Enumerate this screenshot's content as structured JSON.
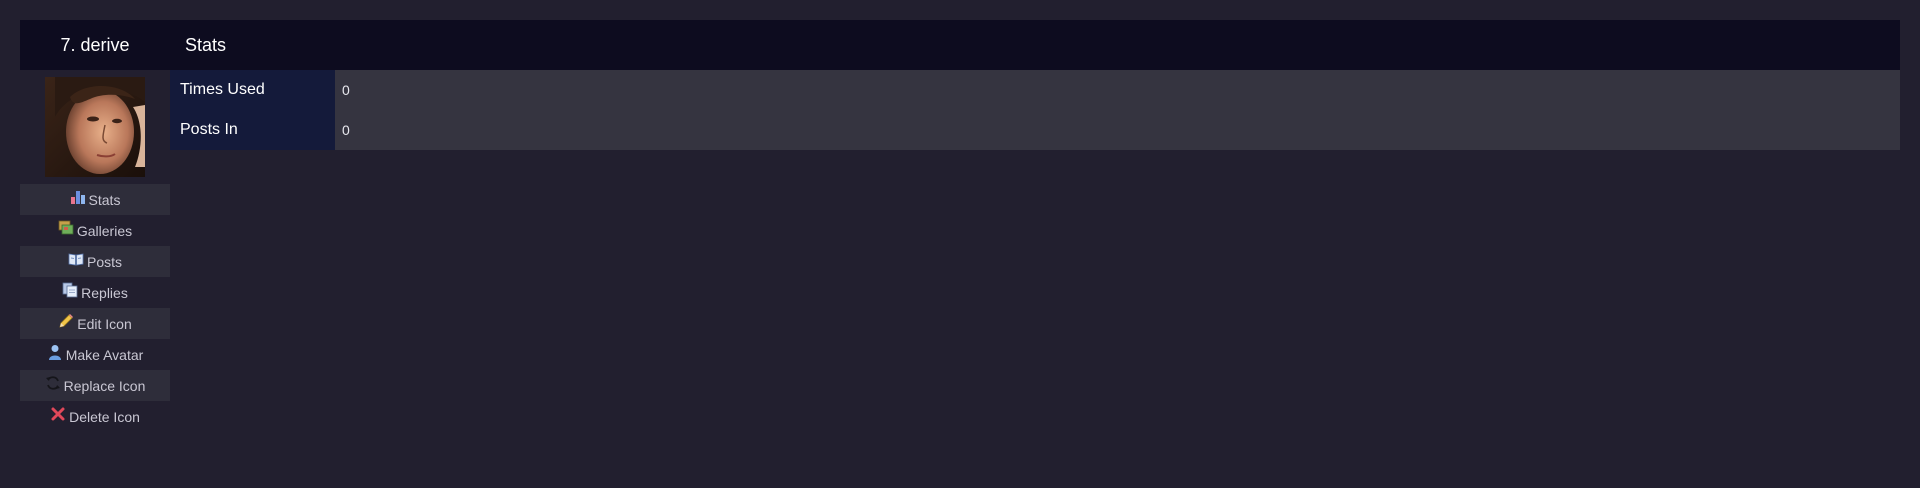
{
  "header": {
    "icon_name": "7. derive",
    "section_title": "Stats"
  },
  "sidebar": {
    "items": [
      {
        "label": "Stats",
        "icon": "bar-chart-icon"
      },
      {
        "label": "Galleries",
        "icon": "galleries-icon"
      },
      {
        "label": "Posts",
        "icon": "book-icon"
      },
      {
        "label": "Replies",
        "icon": "pages-icon"
      },
      {
        "label": "Edit Icon",
        "icon": "pencil-icon"
      },
      {
        "label": "Make Avatar",
        "icon": "user-icon"
      },
      {
        "label": "Replace Icon",
        "icon": "refresh-icon"
      },
      {
        "label": "Delete Icon",
        "icon": "delete-x-icon"
      }
    ]
  },
  "stats": {
    "rows": [
      {
        "key": "Times Used",
        "value": "0"
      },
      {
        "key": "Posts In",
        "value": "0"
      }
    ]
  },
  "colors": {
    "page_bg": "#221f2f",
    "header_bg": "#0d0c1f",
    "key_cell_bg": "#141a3a",
    "value_row_bg": "#353440",
    "menu_alt_bg": "#2e2d3a"
  }
}
